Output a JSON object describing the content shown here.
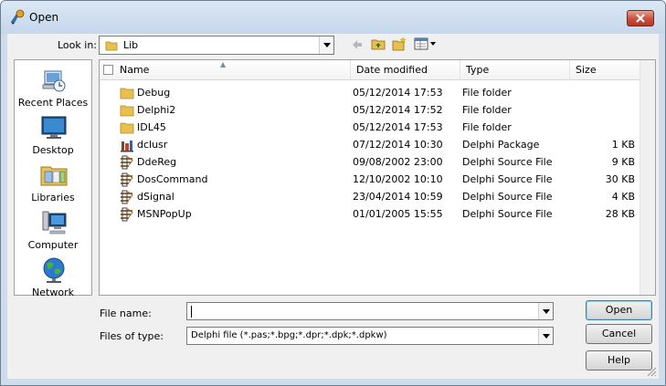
{
  "window": {
    "title": "Open",
    "close_icon": "close-icon",
    "app_icon": "delphi-app-icon"
  },
  "look_in": {
    "label": "Look in:",
    "value": "Lib",
    "icon": "folder-icon"
  },
  "toolbar": {
    "icons": [
      "back-arrow-icon",
      "up-folder-icon",
      "new-folder-icon",
      "view-menu-icon"
    ]
  },
  "places": [
    {
      "label": "Recent Places",
      "icon": "recent-places-icon"
    },
    {
      "label": "Desktop",
      "icon": "desktop-icon"
    },
    {
      "label": "Libraries",
      "icon": "libraries-icon"
    },
    {
      "label": "Computer",
      "icon": "computer-icon"
    },
    {
      "label": "Network",
      "icon": "network-icon"
    }
  ],
  "columns": {
    "name": "Name",
    "date": "Date modified",
    "type": "Type",
    "size": "Size"
  },
  "files": [
    {
      "name": "Debug",
      "date": "05/12/2014 17:53",
      "type": "File folder",
      "size": "",
      "icon": "folder-icon"
    },
    {
      "name": "Delphi2",
      "date": "05/12/2014 17:52",
      "type": "File folder",
      "size": "",
      "icon": "folder-icon"
    },
    {
      "name": "IDL45",
      "date": "05/12/2014 17:53",
      "type": "File folder",
      "size": "",
      "icon": "folder-icon"
    },
    {
      "name": "dclusr",
      "date": "07/12/2014 10:30",
      "type": "Delphi Package",
      "size": "1 KB",
      "icon": "delphi-package-icon"
    },
    {
      "name": "DdeReg",
      "date": "09/08/2002 23:00",
      "type": "Delphi Source File",
      "size": "9 KB",
      "icon": "delphi-source-icon"
    },
    {
      "name": "DosCommand",
      "date": "12/10/2002 10:10",
      "type": "Delphi Source File",
      "size": "30 KB",
      "icon": "delphi-source-icon"
    },
    {
      "name": "dSignal",
      "date": "23/04/2014 10:59",
      "type": "Delphi Source File",
      "size": "4 KB",
      "icon": "delphi-source-icon"
    },
    {
      "name": "MSNPopUp",
      "date": "01/01/2005 15:55",
      "type": "Delphi Source File",
      "size": "28 KB",
      "icon": "delphi-source-icon"
    }
  ],
  "file_name": {
    "label": "File name:",
    "value": ""
  },
  "file_type": {
    "label": "Files of type:",
    "value": "Delphi file (*.pas;*.bpg;*.dpr;*.dpk;*.dpkw)"
  },
  "buttons": {
    "open": "Open",
    "cancel": "Cancel",
    "help": "Help"
  }
}
